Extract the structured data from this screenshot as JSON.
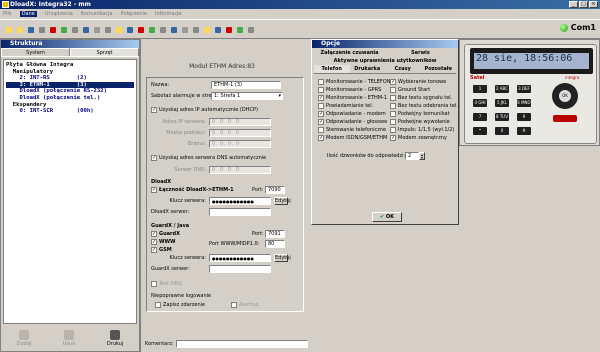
{
  "app": {
    "title": "DloadX: Integra32 - mm"
  },
  "menu": [
    "Plik",
    "Dane",
    "Urządzenia",
    "Komunikacja",
    "Połączenie",
    "Informacje"
  ],
  "status": {
    "com_label": "Com1"
  },
  "structure": {
    "title": "Struktura",
    "tabs": [
      "System",
      "Sprzęt"
    ],
    "tree": [
      "Płyta Główna Integra",
      "  Manipulatory",
      "    2: INT-RS        (2)",
      "    3: ETHM-1        (3)",
      "    DloadX (połączenie RS-232)",
      "    DloadX (połączenie tel.)",
      "  Ekspandery",
      "    0: INT-SCR       (00h)"
    ],
    "buttons": [
      "Dodaj",
      "Usuń",
      "Drukuj"
    ]
  },
  "module": {
    "header": "Moduł ETHM Adres:83",
    "name_label": "Nazwa:",
    "name_value": "ETHM-1    (3)",
    "sabotage_label": "Sabotaż alarmuje w strefie:",
    "sabotage_value": "1: Strefa 1",
    "dhcp_label": "Uzyskaj adres IP automatycznie (DHCP)",
    "ip_label": "Adres IP serwera:",
    "mask_label": "Maska podsieci:",
    "gw_label": "Brama:",
    "ip_value": "0 .   0 .   0 .   0",
    "dns_auto_label": "Uzyskaj adres serwera DNS automatycznie",
    "dns_label": "Serwer DNS:",
    "dloadx_title": "DloadX",
    "link_label": "Łączność DloadX->ETHM-1",
    "port_label": "Port:",
    "port_value": "7090",
    "key_label": "Klucz serwera:",
    "key_value": "●●●●●●●●●●●●",
    "edit_label": "Edytuj",
    "dloadx_server_label": "DloadX serwer:",
    "guardx_title": "GuardX / Java",
    "guardx_label": "GuardX",
    "guardx_port": "7091",
    "www_label": "WWW",
    "www_port_label": "Port WWW/MIDP1.0:",
    "www_port": "80",
    "gsm_label": "GSM",
    "key_value2": "●●●●●●●●●●●●",
    "guardx_server_label": "GuardX serwer:",
    "test_ping": "Test PING",
    "log_title": "Niepoprawne logowanie",
    "block_label": "Zapisz zdarzenie",
    "alarm_label": "Alarmuj",
    "comment_label": "Komentarz:"
  },
  "options": {
    "title": "Opcje",
    "tabs_row1": [
      "Załączenie czuwania",
      "Serwis"
    ],
    "tabs_row2": [
      "Aktywne uprawnienia użytkowników"
    ],
    "tabs_row3": [
      "Telefon",
      "Drukarka",
      "Czasy",
      "Pozostałe"
    ],
    "left": [
      {
        "label": "Monitorowanie - TELEFON",
        "checked": false
      },
      {
        "label": "Monitorowanie - GPRS",
        "checked": false
      },
      {
        "label": "Monitorowanie - ETHM-1",
        "checked": true
      },
      {
        "label": "Powiadamianie tel.",
        "checked": false
      },
      {
        "label": "Odpowiadanie - modem",
        "checked": true
      },
      {
        "label": "Odpowiadanie - głosowe",
        "checked": true
      },
      {
        "label": "Sterowanie telefoniczne",
        "checked": false
      },
      {
        "label": "Modem ISDN/GSM/ETHM",
        "checked": true
      }
    ],
    "right": [
      {
        "label": "Wybieranie tonowe",
        "checked": true
      },
      {
        "label": "Ground Start",
        "checked": false
      },
      {
        "label": "Bez testu sygnału tel.",
        "checked": false
      },
      {
        "label": "Bez testu odebrania tel.",
        "checked": false
      },
      {
        "label": "Podwójny komunikat",
        "checked": false
      },
      {
        "label": "Podwójne wywołanie",
        "checked": false
      },
      {
        "label": "Impuls: 1/1,5 (wył.1/2)",
        "checked": false
      },
      {
        "label": "Modem zewnętrzny",
        "checked": true
      }
    ],
    "rings_label": "Ilość dzwonków do odpowiedzi:",
    "rings_value": "2",
    "ok_label": "OK"
  },
  "keypad": {
    "lcd": "28 sie, 18:56:06",
    "brand": "Satel",
    "model": "integra",
    "keys": [
      "1",
      "2 ABC",
      "3 DEF",
      "4 GHI",
      "5 JKL",
      "6 MNO",
      "7 PQRS",
      "8 TUV",
      "9 WXYZ",
      "*",
      "0",
      "#"
    ]
  }
}
